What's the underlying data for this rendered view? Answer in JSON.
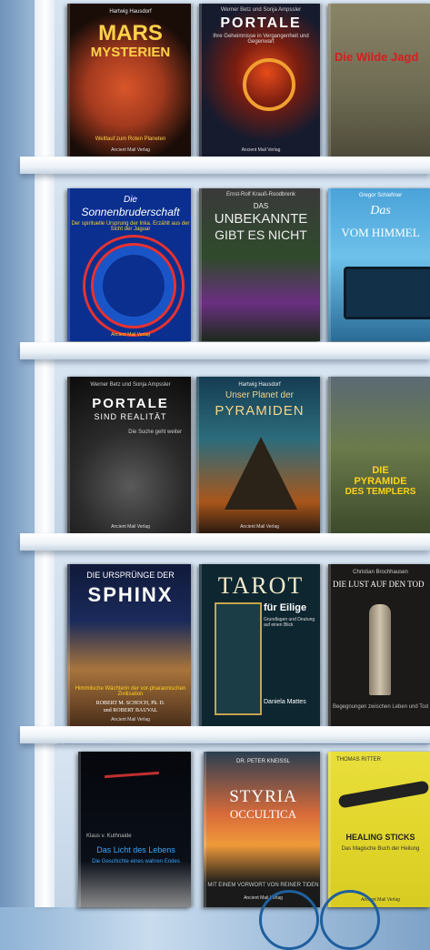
{
  "books": {
    "b1": {
      "author": "Hartwig Hausdorf",
      "title1": "MARS",
      "title2": "MYSTERIEN",
      "sub": "Weltlauf zum Roten Planeten",
      "publisher": "Ancient Mail Verlag"
    },
    "b2": {
      "author": "Werner Betz und Sonja Ampssler",
      "title": "PORTALE",
      "sub": "Ihre Geheimnisse in Vergangenheit und Gegenwart",
      "publisher": "Ancient Mail Verlag"
    },
    "b3": {
      "title": "Die Wilde Jagd"
    },
    "b4": {
      "title1": "Die",
      "title2": "Sonnenbruderschaft",
      "sub": "Der spirituelle Ursprung der Inka. Erzählt aus der Sicht der Jaguar",
      "publisher": "Ancient Mail Verlag"
    },
    "b5": {
      "author": "Ernst-Rolf Krauß-Roodbrenk",
      "title1": "DAS",
      "title2": "UNBEKANNTE",
      "title3": "GIBT ES NICHT"
    },
    "b6": {
      "author": "Gregor Schiefmer",
      "title1": "Das",
      "title2": "VOM HIMMEL"
    },
    "b7": {
      "author": "Werner Betz und Sonja Ampssler",
      "title1": "PORTALE",
      "title2": "SIND REALITÄT",
      "sub": "Die Suche geht weiter",
      "publisher": "Ancient Mail Verlag"
    },
    "b8": {
      "author": "Hartwig Hausdorf",
      "title1": "Unser Planet der",
      "title2": "PYRAMIDEN",
      "publisher": "Ancient Mail Verlag"
    },
    "b9": {
      "title1": "DIE",
      "title2": "PYRAMIDE",
      "title3": "DES TEMPLERS"
    },
    "b10": {
      "title1": "DIE URSPRÜNGE DER",
      "title2": "SPHINX",
      "sub": "Himmlische Wächterin der vor-pharaonischen Zivilisation",
      "author1": "ROBERT M. SCHOCH, Ph. D.",
      "author2": "und ROBERT BAUVAL",
      "publisher": "Ancient Mail Verlag"
    },
    "b11": {
      "title1": "TAROT",
      "title2": "für Eilige",
      "sub": "Grundlagen und Deutung auf einen Blick",
      "author": "Daniela Mattes"
    },
    "b12": {
      "author": "Christian Brochhausen",
      "title": "DIE LUST AUF DEN TOD",
      "sub": "Begegnungen zwischen Leben und Tod"
    },
    "b13": {
      "author": "Klaus v. Kuthnaide",
      "title1": "Das Licht des Lebens",
      "title2": "Die Geschichte eines wahren Endes"
    },
    "b14": {
      "author": "DR. PETER KNEISSL",
      "title1": "STYRIA",
      "title2": "OCCULTICA",
      "sub": "MIT EINEM VORWORT VON REINER TIDEN",
      "publisher": "Ancient Mail Verlag"
    },
    "b15": {
      "author": "THOMAS RITTER",
      "title": "HEALING STICKS",
      "sub": "Das Magische Buch der Heilung",
      "publisher": "Ancient Mail Verlag"
    }
  },
  "colors": {
    "accent": "#1f5f9e",
    "shelf": "#eef3f8"
  }
}
